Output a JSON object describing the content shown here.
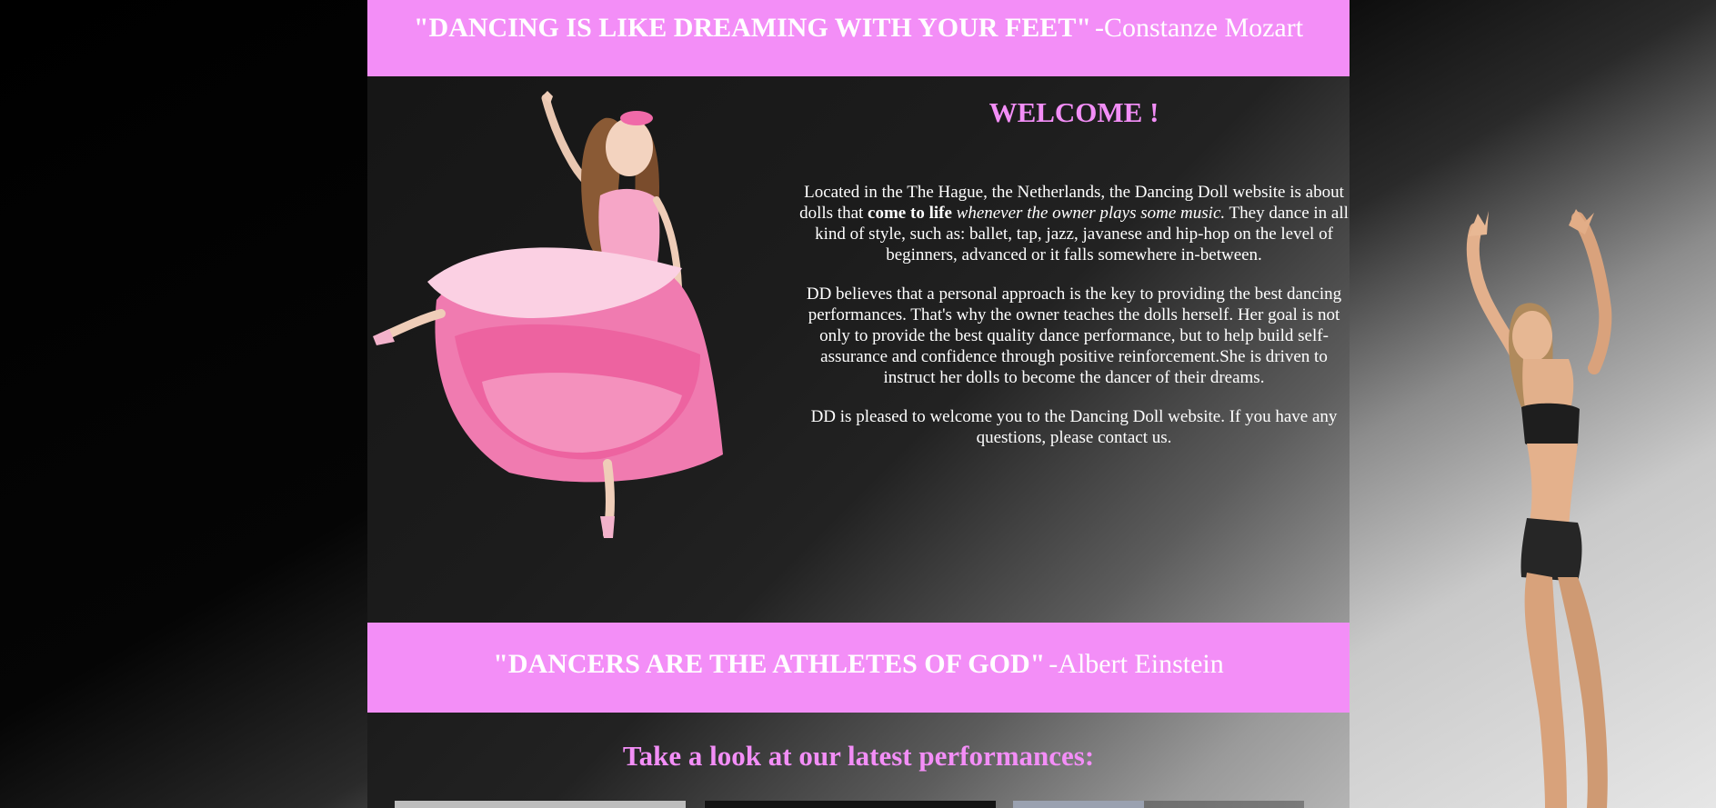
{
  "top_quote": {
    "text": "\"DANCING IS LIKE DREAMING WITH YOUR FEET\"",
    "author": "-Constanze Mozart"
  },
  "welcome": {
    "title": "WELCOME !",
    "p1_a": "Located in the The Hague, the Netherlands, the Dancing Doll website is about dolls that ",
    "p1_bold": "come to life",
    "p1_italic": "whenever the owner plays some music.",
    "p1_b": " They dance in all kind of style, such as: ballet, tap, jazz, javanese and hip-hop on the level of beginners, advanced or it falls somewhere in-between.",
    "p2": "DD believes that a personal approach is the key to providing the best dancing performances. That's why the owner teaches the dolls herself. Her goal is not only to provide the best quality dance performance, but to help build self-assurance and confidence through positive reinforcement.She is driven to instruct her dolls to become the dancer of their dreams.",
    "p3": "DD is pleased to welcome you to the Dancing Doll website. If you have any questions, please contact us."
  },
  "mid_quote": {
    "text": "\"DANCERS ARE THE ATHLETES OF GOD\"",
    "author": "-Albert Einstein"
  },
  "performances": {
    "title": "Take a look at our latest performances:"
  },
  "colors": {
    "accent_pink": "#f38ef7",
    "panel_dark": "#1c1c1c"
  },
  "images": {
    "doll": "ballerina-doll-image",
    "side_dancer": "girl-dancer-image"
  }
}
